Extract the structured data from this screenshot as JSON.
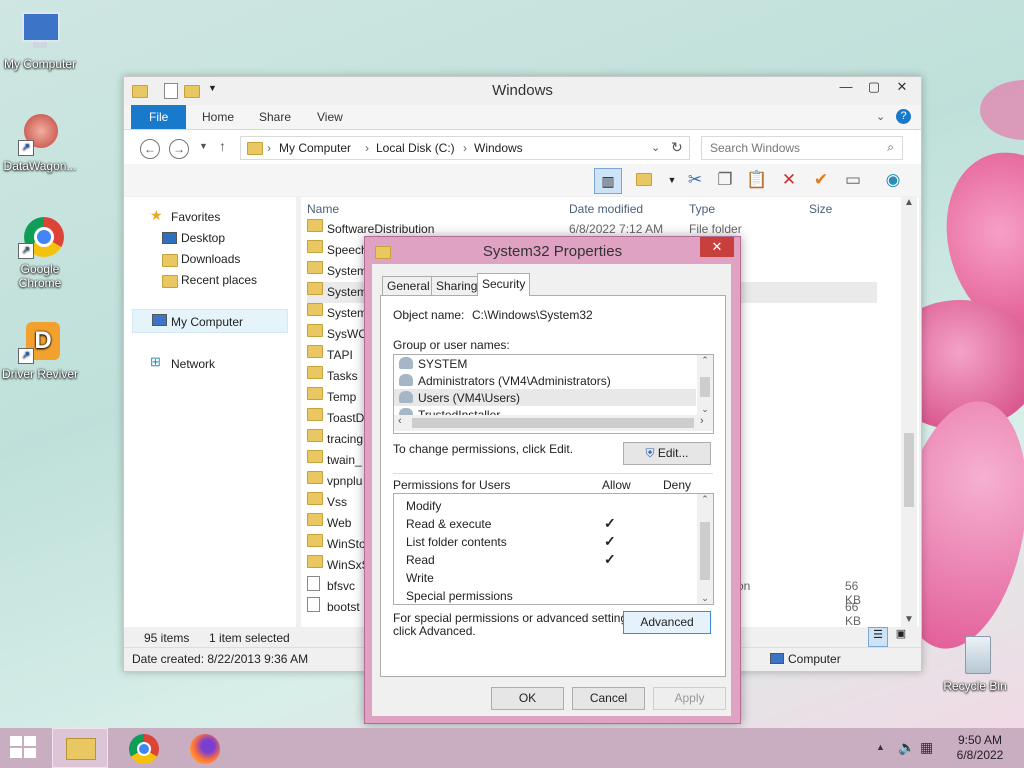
{
  "desktop": {
    "icons": [
      {
        "label": "My Computer"
      },
      {
        "label": "DataWagon..."
      },
      {
        "label": "Google Chrome"
      },
      {
        "label": "Driver Reviver"
      },
      {
        "label": "Recycle Bin"
      }
    ]
  },
  "explorer": {
    "title": "Windows",
    "ribbon_tabs": [
      "File",
      "Home",
      "Share",
      "View"
    ],
    "breadcrumb": [
      "My Computer",
      "Local Disk (C:)",
      "Windows"
    ],
    "search_placeholder": "Search Windows",
    "nav": {
      "favorites": "Favorites",
      "desktop": "Desktop",
      "downloads": "Downloads",
      "recent": "Recent places",
      "computer": "My Computer",
      "network": "Network"
    },
    "columns": [
      "Name",
      "Date modified",
      "Type",
      "Size"
    ],
    "files": [
      {
        "name": "SoftwareDistribution",
        "date": "6/8/2022 7:12 AM",
        "type": "File folder",
        "size": ""
      },
      {
        "name": "Speech",
        "date": "",
        "type": "",
        "size": ""
      },
      {
        "name": "System",
        "date": "",
        "type": "",
        "size": ""
      },
      {
        "name": "System",
        "date": "",
        "type": "",
        "size": ""
      },
      {
        "name": "System",
        "date": "",
        "type": "",
        "size": ""
      },
      {
        "name": "SysWO",
        "date": "",
        "type": "",
        "size": ""
      },
      {
        "name": "TAPI",
        "date": "",
        "type": "",
        "size": ""
      },
      {
        "name": "Tasks",
        "date": "",
        "type": "",
        "size": ""
      },
      {
        "name": "Temp",
        "date": "",
        "type": "",
        "size": ""
      },
      {
        "name": "ToastD",
        "date": "",
        "type": "",
        "size": ""
      },
      {
        "name": "tracing",
        "date": "",
        "type": "",
        "size": ""
      },
      {
        "name": "twain_",
        "date": "",
        "type": "",
        "size": ""
      },
      {
        "name": "vpnplu",
        "date": "",
        "type": "",
        "size": ""
      },
      {
        "name": "Vss",
        "date": "",
        "type": "",
        "size": ""
      },
      {
        "name": "Web",
        "date": "",
        "type": "",
        "size": ""
      },
      {
        "name": "WinSto",
        "date": "",
        "type": "",
        "size": ""
      },
      {
        "name": "WinSxS",
        "date": "",
        "type": "",
        "size": ""
      },
      {
        "name": "bfsvc",
        "date": "",
        "type": "on",
        "size": "56 KB"
      },
      {
        "name": "bootst",
        "date": "",
        "type": "",
        "size": "66 KB"
      }
    ],
    "status": {
      "items": "95 items",
      "selected": "1 item selected"
    },
    "details": {
      "created": "Date created: 8/22/2013 9:36 AM",
      "location": "Computer"
    }
  },
  "dialog": {
    "title": "System32 Properties",
    "tabs": [
      "General",
      "Sharing",
      "Security"
    ],
    "object_label": "Object name:",
    "object_value": "C:\\Windows\\System32",
    "group_label": "Group or user names:",
    "groups": [
      "SYSTEM",
      "Administrators (VM4\\Administrators)",
      "Users (VM4\\Users)",
      "TrustedInstaller"
    ],
    "change_text": "To change permissions, click Edit.",
    "edit_button": "Edit...",
    "perm_header": "Permissions for Users",
    "allow_header": "Allow",
    "deny_header": "Deny",
    "permissions": [
      {
        "name": "Modify",
        "allow": false
      },
      {
        "name": "Read & execute",
        "allow": true
      },
      {
        "name": "List folder contents",
        "allow": true
      },
      {
        "name": "Read",
        "allow": true
      },
      {
        "name": "Write",
        "allow": false
      },
      {
        "name": "Special permissions",
        "allow": false
      }
    ],
    "check_mark": "✓",
    "special_text_1": "For special permissions or advanced settings,",
    "special_text_2": "click Advanced.",
    "advanced_button": "Advanced",
    "ok": "OK",
    "cancel": "Cancel",
    "apply": "Apply"
  },
  "taskbar": {
    "time": "9:50 AM",
    "date": "6/8/2022"
  }
}
